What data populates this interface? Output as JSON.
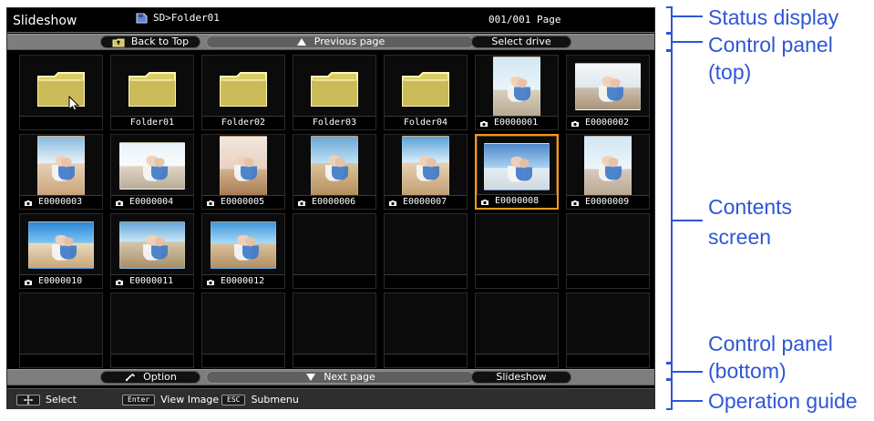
{
  "status": {
    "title": "Slideshow",
    "path": "SD>Folder01",
    "page": "001/001 Page"
  },
  "control_top": {
    "left_label": "Back to Top",
    "middle_label": "Previous page",
    "right_label": "Select drive"
  },
  "grid": {
    "tiles": [
      {
        "kind": "folder_root",
        "label": ""
      },
      {
        "kind": "folder",
        "label": "Folder01"
      },
      {
        "kind": "folder",
        "label": "Folder02"
      },
      {
        "kind": "folder",
        "label": "Folder03"
      },
      {
        "kind": "folder",
        "label": "Folder04"
      },
      {
        "kind": "image",
        "label": "E0000001",
        "theme": "p1",
        "portrait": true
      },
      {
        "kind": "image",
        "label": "E0000002",
        "theme": "p2",
        "portrait": false
      },
      {
        "kind": "image",
        "label": "E0000003",
        "theme": "p3",
        "portrait": true
      },
      {
        "kind": "image",
        "label": "E0000004",
        "theme": "p4",
        "portrait": false
      },
      {
        "kind": "image",
        "label": "E0000005",
        "theme": "p5",
        "portrait": true
      },
      {
        "kind": "image",
        "label": "E0000006",
        "theme": "p6",
        "portrait": true
      },
      {
        "kind": "image",
        "label": "E0000007",
        "theme": "p7",
        "portrait": true
      },
      {
        "kind": "image",
        "label": "E0000008",
        "theme": "p8",
        "portrait": false,
        "selected": true
      },
      {
        "kind": "image",
        "label": "E0000009",
        "theme": "p9",
        "portrait": true
      },
      {
        "kind": "image",
        "label": "E0000010",
        "theme": "p10",
        "portrait": false
      },
      {
        "kind": "image",
        "label": "E0000011",
        "theme": "p11",
        "portrait": false
      },
      {
        "kind": "image",
        "label": "E0000012",
        "theme": "p12",
        "portrait": false
      },
      {
        "kind": "empty",
        "label": ""
      },
      {
        "kind": "empty",
        "label": ""
      },
      {
        "kind": "empty",
        "label": ""
      },
      {
        "kind": "empty",
        "label": ""
      },
      {
        "kind": "empty",
        "label": ""
      },
      {
        "kind": "empty",
        "label": ""
      },
      {
        "kind": "empty",
        "label": ""
      },
      {
        "kind": "empty",
        "label": ""
      },
      {
        "kind": "empty",
        "label": ""
      },
      {
        "kind": "empty",
        "label": ""
      },
      {
        "kind": "empty",
        "label": ""
      }
    ]
  },
  "control_bottom": {
    "left_label": "Option",
    "middle_label": "Next page",
    "right_label": "Slideshow"
  },
  "guide": {
    "items": [
      {
        "key": "",
        "label": "Select"
      },
      {
        "key": "Enter",
        "label": "View Image"
      },
      {
        "key": "ESC",
        "label": "Submenu"
      }
    ]
  },
  "callouts": {
    "status_display": "Status display",
    "control_top_line1": "Control panel",
    "control_top_line2": "(top)",
    "contents_line1": "Contents",
    "contents_line2": "screen",
    "control_bottom_line1": "Control panel",
    "control_bottom_line2": "(bottom)",
    "operation_guide": "Operation guide"
  },
  "colors": {
    "callout_blue": "#2f56d6",
    "selection_orange": "#f39a21"
  }
}
